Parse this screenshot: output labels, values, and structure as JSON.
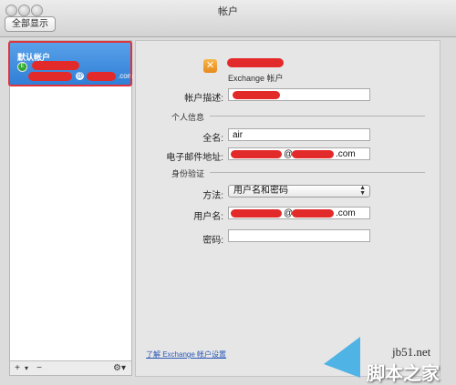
{
  "window": {
    "title": "帐户"
  },
  "toolbar": {
    "show_all_label": "全部显示"
  },
  "sidebar": {
    "account_title": "默认帐户",
    "account_email_domain": ".com",
    "at_symbol": "@"
  },
  "bottombar": {
    "add": "+",
    "add_menu": "▾",
    "remove": "−",
    "gear": "⚙▾"
  },
  "account": {
    "type_label": "Exchange 帐户",
    "description_label": "帐户描述:",
    "section_personal": "个人信息",
    "fullname_label": "全名:",
    "fullname_value": "air",
    "email_label": "电子邮件地址:",
    "email_suffix": "@",
    "email_domain": ".com",
    "section_auth": "身份验证",
    "method_label": "方法:",
    "method_value": "用户名和密码",
    "username_label": "用户名:",
    "username_suffix": "@",
    "username_domain": ".com",
    "password_label": "密码:",
    "learn_more": "了解 Exchange 帐户设置"
  },
  "watermark": {
    "site": "jb51.net",
    "name": "脚本之家"
  },
  "colors": {
    "selection": "#3b87dc",
    "redaction": "#e32a2a",
    "highlight_border": "#e0333a"
  }
}
